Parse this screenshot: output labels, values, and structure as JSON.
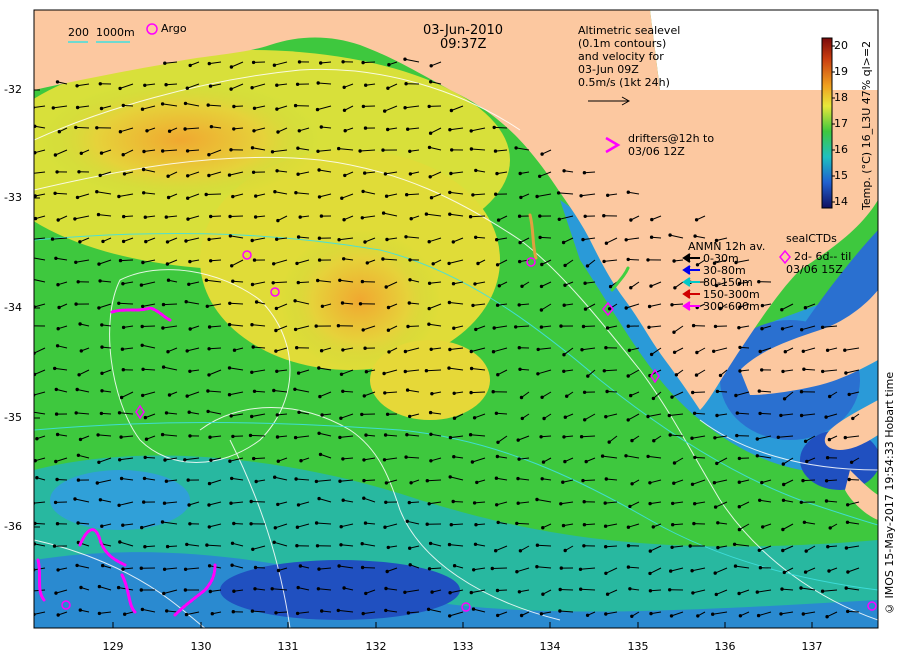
{
  "header": {
    "date": "03-Jun-2010",
    "time": "09:37Z"
  },
  "scale_legend": {
    "labels": [
      "200",
      "1000m"
    ],
    "argo_label": "Argo"
  },
  "altimetry_note": {
    "lines": [
      "Altimetric sealevel",
      "(0.1m contours)",
      "and velocity for",
      "03-Jun 09Z"
    ],
    "arrow_scale": "0.5m/s (1kt 24h)"
  },
  "drifters_note": {
    "lines": [
      "drifters@12h to",
      "03/06 12Z"
    ]
  },
  "anmn_legend": {
    "title": "ANMN 12h av.",
    "items": [
      {
        "label": "0-30m",
        "color": "#000000"
      },
      {
        "label": "30-80m",
        "color": "#0000ee"
      },
      {
        "label": "80-150m",
        "color": "#00c8c8"
      },
      {
        "label": "150-300m",
        "color": "#d00000"
      },
      {
        "label": "300-600m",
        "color": "#ff00ff"
      }
    ]
  },
  "seal_legend": {
    "title": "sealCTDs",
    "line2": "2d- 6d-- til",
    "line3": "03/06 15Z"
  },
  "colorbar": {
    "title": "Temp. (°C) 16_L3U 47% ql>=2",
    "ticks": [
      "20",
      "19",
      "18",
      "17",
      "16",
      "15",
      "14"
    ]
  },
  "credit": "© IMOS 15-May-2017 19:54:33 Hobart time",
  "axes": {
    "y_ticks": [
      "-32",
      "-33",
      "-34",
      "-35",
      "-36"
    ],
    "x_ticks": [
      "129",
      "130",
      "131",
      "132",
      "133",
      "134",
      "135",
      "136",
      "137"
    ]
  },
  "colors": {
    "land": "#fcc8a0",
    "cold": "#1a2a9a",
    "cool": "#20b8d8",
    "mid": "#3ec83e",
    "warm": "#e8e83a",
    "hot": "#f0a020"
  }
}
